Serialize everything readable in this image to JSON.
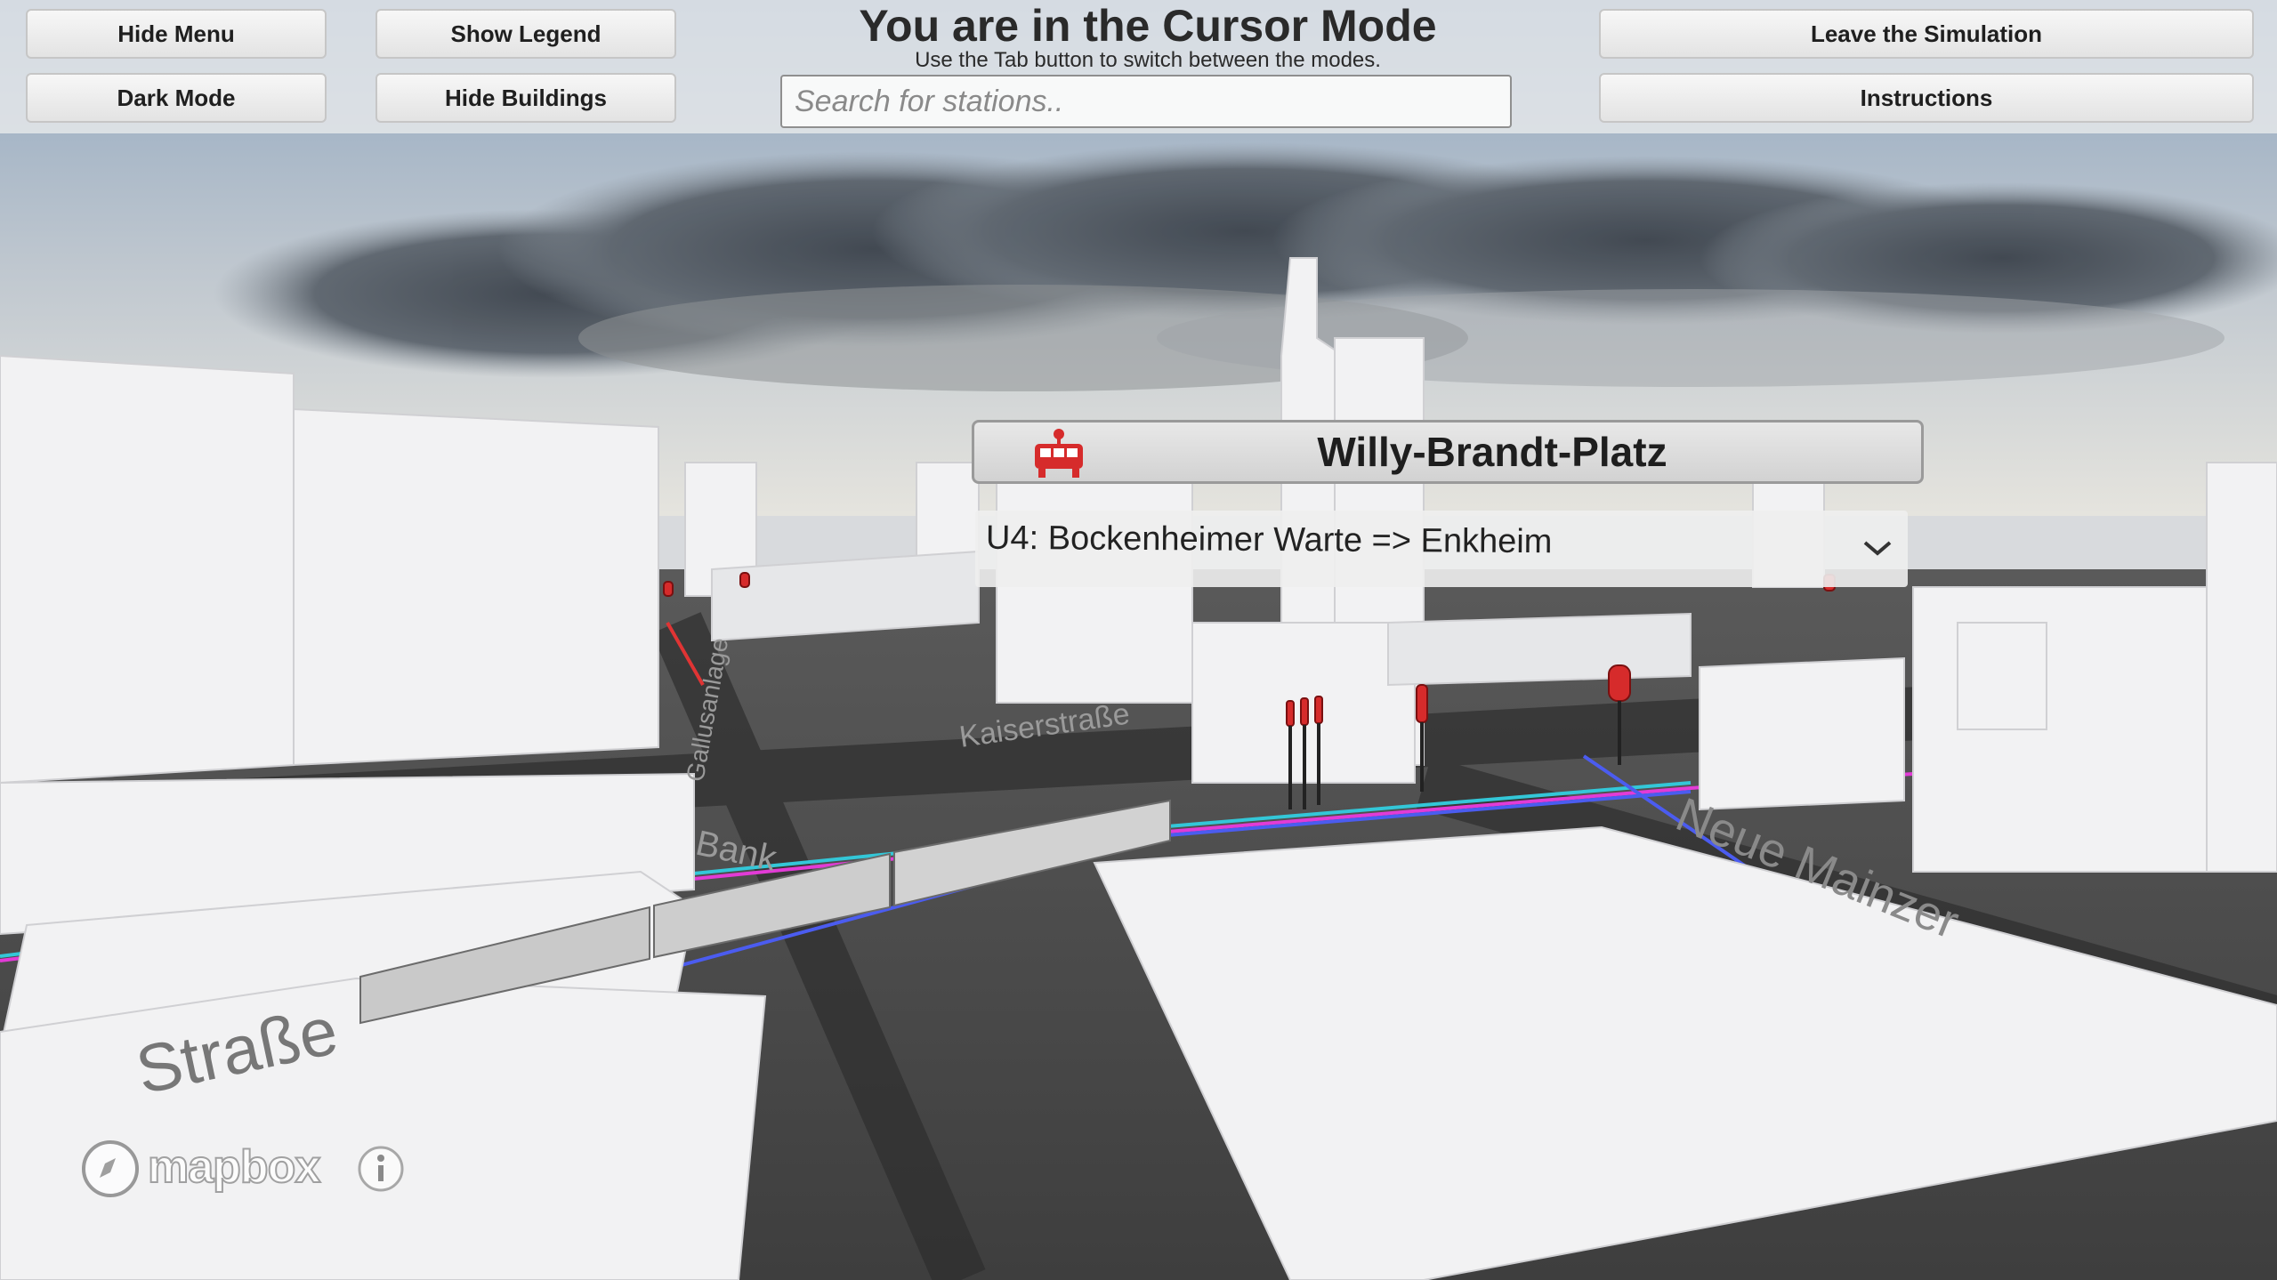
{
  "toolbar": {
    "hide_menu": "Hide Menu",
    "show_legend": "Show Legend",
    "dark_mode": "Dark Mode",
    "hide_buildings": "Hide Buildings",
    "leave_simulation": "Leave the Simulation",
    "instructions": "Instructions"
  },
  "mode": {
    "title": "You are in the Cursor Mode",
    "subtitle": "Use the Tab button to switch between the modes."
  },
  "search": {
    "placeholder": "Search for stations.."
  },
  "station_popup": {
    "icon": "tram-icon",
    "name": "Willy-Brandt-Platz",
    "selected_line": "U4: Bockenheimer Warte => Enkheim"
  },
  "map": {
    "street_labels": [
      "Kaiserstraße",
      "Neue Mainzer",
      "Bank",
      "Straße",
      "Gallusanlage"
    ],
    "attribution": "mapbox",
    "colors": {
      "station_marker": "#d62b2b",
      "line_blue": "#4b5cf0",
      "line_magenta": "#e23bd6",
      "line_cyan": "#33c7d8",
      "line_red": "#e03434"
    }
  }
}
